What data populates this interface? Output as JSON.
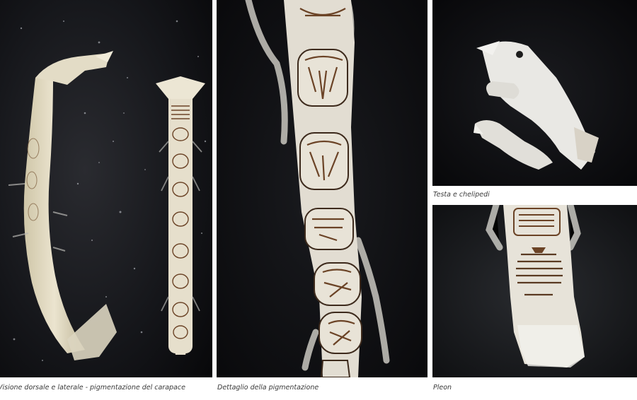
{
  "captions": {
    "dorsal_lateral": "Visione dorsale e laterale - pigmentazione del carapace",
    "pigmentation_detail": "Dettaglio della pigmentazione",
    "head_chelipeds": "Testa e chelipedi",
    "pleon": "Pleon"
  },
  "colors": {
    "background_dark": "#0c0c0e",
    "body_cream": "#e6dfcc",
    "pigment_brown": "#6b4326"
  }
}
